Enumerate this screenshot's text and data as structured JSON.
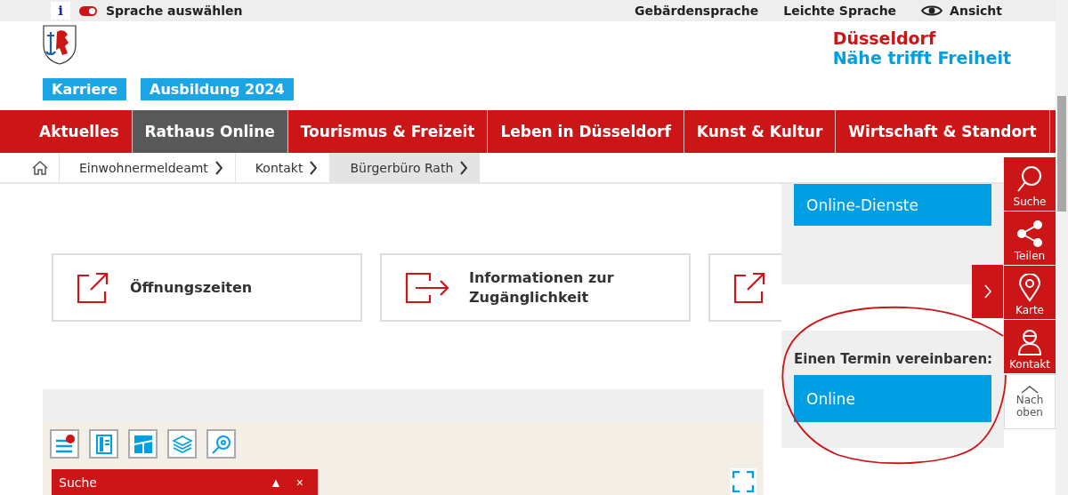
{
  "top_bar": {
    "info": "i",
    "language": {
      "label": "Sprache auswählen",
      "on": true
    },
    "links": [
      {
        "label": "Gebärdensprache",
        "kind": "text"
      },
      {
        "label": "Leichte Sprache",
        "kind": "text"
      },
      {
        "label": "Ansicht",
        "kind": "eye"
      }
    ]
  },
  "header": {
    "brand_lines": [
      "Düsseldorf",
      "Nähe trifft Freiheit"
    ],
    "quick_links": [
      "Karriere",
      "Ausbildung 2024"
    ]
  },
  "nav": [
    {
      "label": "Aktuelles",
      "selected": false
    },
    {
      "label": "Rathaus Online",
      "selected": true
    },
    {
      "label": "Tourismus & Freizeit",
      "selected": false
    },
    {
      "label": "Leben in Düsseldorf",
      "selected": false
    },
    {
      "label": "Kunst & Kultur",
      "selected": false
    },
    {
      "label": "Wirtschaft & Standort",
      "selected": false
    }
  ],
  "breadcrumb": [
    {
      "label": "Einwohnermeldeamt",
      "selected": false
    },
    {
      "label": "Kontakt",
      "selected": false
    },
    {
      "label": "Bürgerbüro Rath",
      "selected": true
    }
  ],
  "cards": [
    {
      "label": "Öffnungszeiten",
      "kind": "external"
    },
    {
      "label": "Informationen zur Zugänglichkeit",
      "kind": "arrow"
    },
    {
      "kind": "external"
    }
  ],
  "map": {
    "tools": [
      {
        "kind": "legend"
      },
      {
        "kind": "book"
      },
      {
        "kind": "plan"
      },
      {
        "kind": "layers"
      },
      {
        "kind": "locate"
      }
    ],
    "search_panel": {
      "title": "Suche",
      "collapse": "▲",
      "close": "×"
    }
  },
  "sidebar": {
    "services_button": "Online-Dienste",
    "appointment": {
      "heading": "Einen Termin vereinbaren:",
      "button": "Online"
    }
  },
  "side_tools": [
    {
      "label": "Suche",
      "kind": "search"
    },
    {
      "label": "Teilen",
      "kind": "share"
    },
    {
      "label": "Karte",
      "kind": "map"
    },
    {
      "label": "Kontakt",
      "kind": "contact"
    }
  ],
  "back_to_top": "Nach oben"
}
